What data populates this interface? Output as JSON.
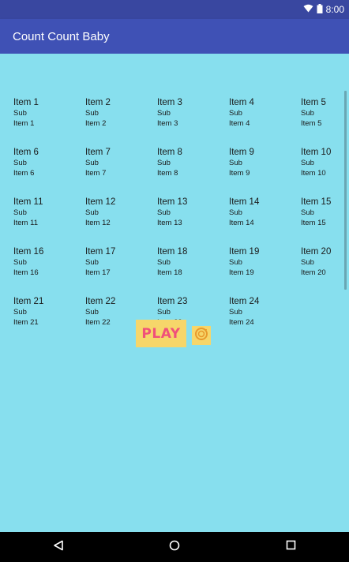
{
  "status": {
    "time": "8:00"
  },
  "app": {
    "title": "Count Count Baby"
  },
  "grid": {
    "items": [
      {
        "title": "Item 1",
        "sub": "Sub",
        "detail": "Item 1"
      },
      {
        "title": "Item 2",
        "sub": "Sub",
        "detail": "Item 2"
      },
      {
        "title": "Item 3",
        "sub": "Sub",
        "detail": "Item 3"
      },
      {
        "title": "Item 4",
        "sub": "Sub",
        "detail": "Item 4"
      },
      {
        "title": "Item 5",
        "sub": "Sub",
        "detail": "Item 5"
      },
      {
        "title": "Item 6",
        "sub": "Sub",
        "detail": "Item 6"
      },
      {
        "title": "Item 7",
        "sub": "Sub",
        "detail": "Item 7"
      },
      {
        "title": "Item 8",
        "sub": "Sub",
        "detail": "Item 8"
      },
      {
        "title": "Item 9",
        "sub": "Sub",
        "detail": "Item 9"
      },
      {
        "title": "Item 10",
        "sub": "Sub",
        "detail": "Item 10"
      },
      {
        "title": "Item 11",
        "sub": "Sub",
        "detail": "Item 11"
      },
      {
        "title": "Item 12",
        "sub": "Sub",
        "detail": "Item 12"
      },
      {
        "title": "Item 13",
        "sub": "Sub",
        "detail": "Item 13"
      },
      {
        "title": "Item 14",
        "sub": "Sub",
        "detail": "Item 14"
      },
      {
        "title": "Item 15",
        "sub": "Sub",
        "detail": "Item 15"
      },
      {
        "title": "Item 16",
        "sub": "Sub",
        "detail": "Item 16"
      },
      {
        "title": "Item 17",
        "sub": "Sub",
        "detail": "Item 17"
      },
      {
        "title": "Item 18",
        "sub": "Sub",
        "detail": "Item 18"
      },
      {
        "title": "Item 19",
        "sub": "Sub",
        "detail": "Item 19"
      },
      {
        "title": "Item 20",
        "sub": "Sub",
        "detail": "Item 20"
      },
      {
        "title": "Item 21",
        "sub": "Sub",
        "detail": "Item 21"
      },
      {
        "title": "Item 22",
        "sub": "Sub",
        "detail": "Item 22"
      },
      {
        "title": "Item 23",
        "sub": "Sub",
        "detail": "Item 23"
      },
      {
        "title": "Item 24",
        "sub": "Sub",
        "detail": "Item 24"
      }
    ]
  },
  "controls": {
    "play_label": "PLAY"
  },
  "colors": {
    "status_bar": "#3947a0",
    "app_bar": "#3f51b5",
    "background": "#87dfee",
    "button_bg": "#f6d66a",
    "play_text": "#f0507a"
  },
  "icons": {
    "status": [
      "wifi-icon",
      "battery-icon"
    ],
    "controls": [
      "replay-icon"
    ],
    "nav": [
      "back-icon",
      "home-icon",
      "recents-icon"
    ]
  }
}
